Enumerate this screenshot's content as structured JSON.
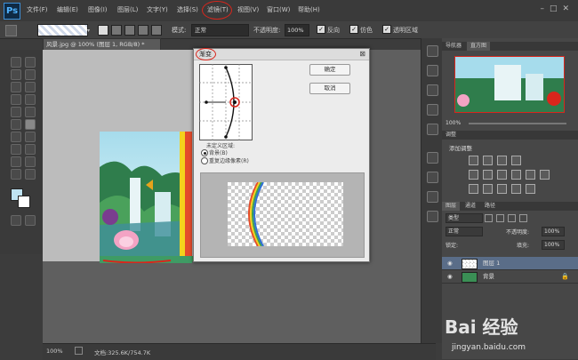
{
  "app": {
    "logo": "Ps"
  },
  "menu": {
    "items": [
      "文件(F)",
      "编辑(E)",
      "图像(I)",
      "图层(L)",
      "文字(Y)",
      "选择(S)",
      "滤镜(T)",
      "视图(V)",
      "窗口(W)",
      "帮助(H)"
    ],
    "highlighted_index": 6
  },
  "options": {
    "mode_label": "模式:",
    "mode_value": "正常",
    "opacity_label": "不透明度:",
    "opacity_value": "100%",
    "check1": "反向",
    "check2": "仿色",
    "check3": "透明区域"
  },
  "document": {
    "tab_title": "风景.jpg @ 100% (图层 1, RGB/8) *",
    "zoom": "100%",
    "doc_size": "文档:325.6K/754.7K"
  },
  "dialog": {
    "title": "渐变",
    "ok": "确定",
    "cancel": "取消",
    "undefined_region": "未定义区域:",
    "opt_bg": "背景(B)",
    "opt_repeat": "重复边缘像素(R)"
  },
  "navigator": {
    "tab_navigator": "导航器",
    "tab_histogram": "直方图",
    "zoom": "100%"
  },
  "adjustments": {
    "tab": "调整",
    "title": "添加调整"
  },
  "layers": {
    "tabs": [
      "图层",
      "通道",
      "路径"
    ],
    "filter": "类型",
    "blend_mode": "正常",
    "opacity_label": "不透明度:",
    "opacity_value": "100%",
    "lock_label": "锁定:",
    "fill_label": "填充:",
    "fill_value": "100%",
    "rows": [
      {
        "name": "图层 1"
      },
      {
        "name": "背景"
      }
    ]
  },
  "watermark": {
    "line1": "Bai 经验",
    "line2": "jingyan.baidu.com"
  },
  "colors": {
    "highlight_red": "#d9261c",
    "accent_blue": "#3c8fd8"
  }
}
